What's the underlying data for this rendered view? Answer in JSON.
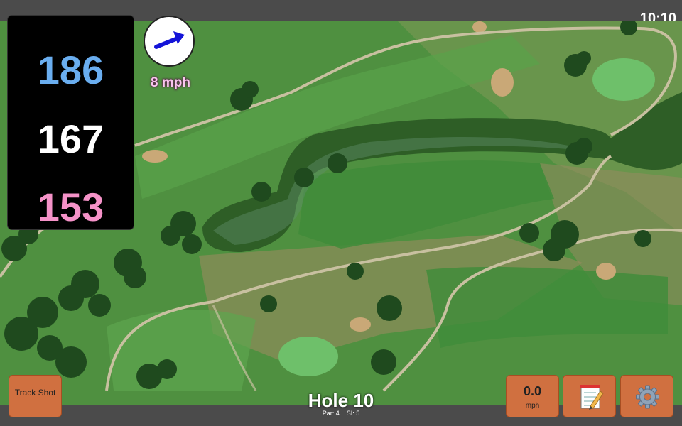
{
  "status": {
    "time": "10:10"
  },
  "distances": {
    "back": "186",
    "middle": "167",
    "front": "153"
  },
  "wind": {
    "label": "8 mph",
    "icon": "wind-arrow-icon"
  },
  "hole": {
    "title": "Hole 10",
    "par_label": "Par: 4",
    "si_label": "SI: 5"
  },
  "buttons": {
    "track_shot": "Track Shot",
    "speed_value": "0.0",
    "speed_unit": "mph",
    "notes_icon": "notepad-icon",
    "settings_icon": "gear-icon"
  },
  "colors": {
    "back": "#6aaef0",
    "middle": "#ffffff",
    "front": "#f592c8",
    "button": "#d07040",
    "water": "#2e5e26"
  }
}
